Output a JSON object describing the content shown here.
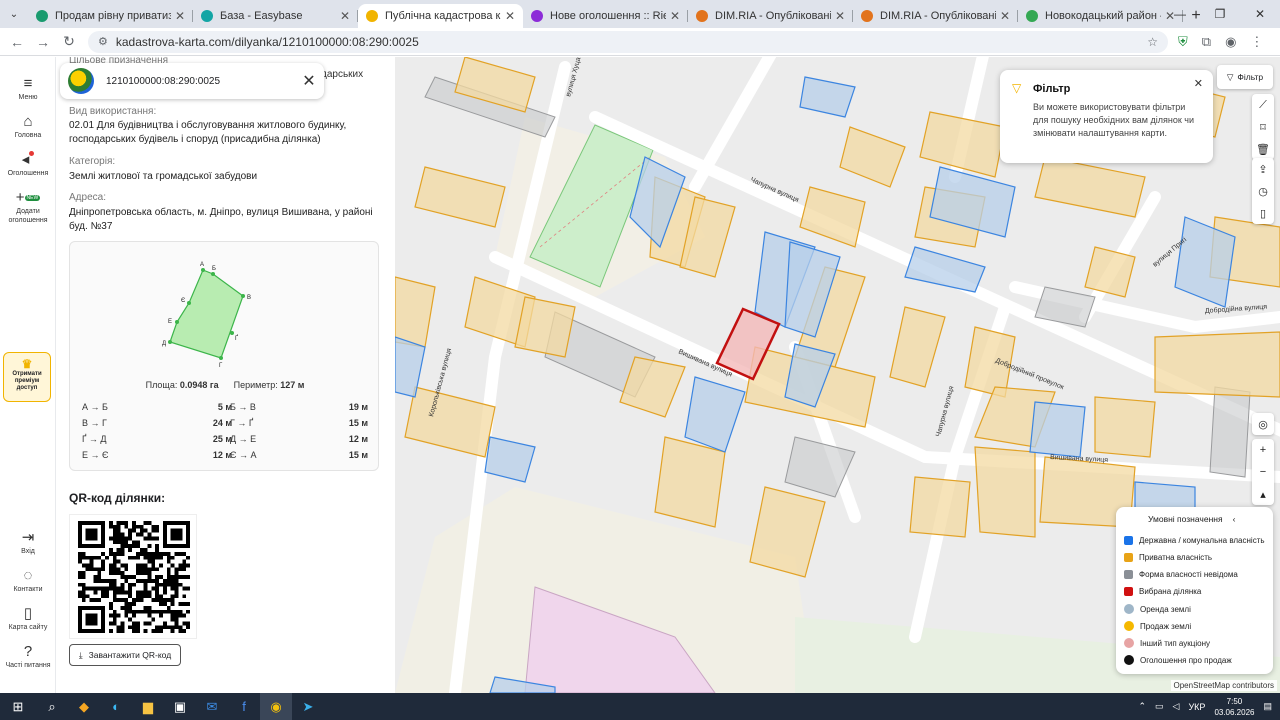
{
  "browser": {
    "tabs": [
      {
        "title": "Продам рівну приватизовану",
        "fav": "#1a9b6f"
      },
      {
        "title": "База - Easybase",
        "fav": "#13a5a5"
      },
      {
        "title": "Публічна кадастрова карта Ук",
        "fav": "#f1b400",
        "active": true
      },
      {
        "title": "Нове оголошення :: Rieltor від",
        "fav": "#8c2bd8"
      },
      {
        "title": "DIM.RIA - Опубліковані оголоше",
        "fav": "#e2731c"
      },
      {
        "title": "DIM.RIA - Опубліковані оголоше",
        "fav": "#e2731c"
      },
      {
        "title": "Новокодацький район – Карт",
        "fav": "#34a853"
      }
    ],
    "url": "kadastrova-karta.com/dilyanka/1210100000:08:290:0025"
  },
  "rail": {
    "items": [
      {
        "label": "Меню",
        "icon": "≡"
      },
      {
        "label": "Головна",
        "icon": "⌂"
      },
      {
        "label": "Оголошення",
        "icon": "◂"
      },
      {
        "label": "Додати оголошення",
        "icon": "+"
      }
    ],
    "premium": "Отримати преміум доступ",
    "bottom": [
      {
        "label": "Вхід",
        "icon": "⇥"
      },
      {
        "label": "Контакти",
        "icon": "◌"
      },
      {
        "label": "Карта сайту",
        "icon": "▯"
      },
      {
        "label": "Часті питання",
        "icon": "?"
      }
    ],
    "new_badge": "NEW"
  },
  "panel": {
    "cadastral_number": "1210100000:08:290:0025",
    "hidden_label": "Цільове призначення",
    "hidden_tail": "дарських",
    "usage_label": "Вид використання:",
    "usage_value": "02.01 Для будівництва і обслуговування житлового будинку, господарських будівель і споруд (присадибна ділянка)",
    "category_label": "Категорія:",
    "category_value": "Землі житлової та громадської забудови",
    "address_label": "Адреса:",
    "address_value": "Дніпропетровська область, м. Дніпро, вулиця Вишивана, у районі буд. №37",
    "area_label": "Площа:",
    "area_value": "0.0948 га",
    "perimeter_label": "Периметр:",
    "perimeter_value": "127 м",
    "vertices": [
      "А",
      "Б",
      "В",
      "Г",
      "Ґ",
      "Д",
      "Е",
      "Є"
    ],
    "segments": [
      {
        "a": "А → Б",
        "av": "5 м",
        "b": "Б → В",
        "bv": "19 м"
      },
      {
        "a": "В → Г",
        "av": "24 м",
        "b": "Г → Ґ",
        "bv": "15 м"
      },
      {
        "a": "Ґ → Д",
        "av": "25 м",
        "b": "Д → Е",
        "bv": "12 м"
      },
      {
        "a": "Е → Є",
        "av": "12 м",
        "b": "Є → А",
        "bv": "15 м"
      }
    ],
    "qr_title": "QR-код ділянки:",
    "qr_button": "Завантажити QR-код"
  },
  "map": {
    "filter_button": "Фільтр",
    "tooltip_title": "Фільтр",
    "tooltip_text": "Ви можете використовувати фільтри для пошуку необхідних вам ділянок чи змінювати налаштування карти.",
    "streets": {
      "chapurna": "Чапурна вулиця",
      "vyshyvana": "Вишивана вулиця",
      "vyshyvana2": "Вишивана вулиця",
      "korolivska": "Корольківська вулиця",
      "dobrodiynyi": "Добродійний провулок",
      "chapurna2": "Чапурна вулиця",
      "prygi": "вулиця Пригі",
      "dobrodiyna": "Добродійна вулиця",
      "khutsa": "вулиця Хуца"
    },
    "legend": {
      "title": "Умовні позначення",
      "items": [
        {
          "label": "Державна / комунальна власність",
          "color": "#1a73e8"
        },
        {
          "label": "Приватна власність",
          "color": "#e8a317"
        },
        {
          "label": "Форма власності невідома",
          "color": "#8a8f96"
        },
        {
          "label": "Вибрана ділянка",
          "color": "#d01010"
        },
        {
          "label": "Оренда землі",
          "color": "#9fb6c8"
        },
        {
          "label": "Продаж землі",
          "color": "#f5b800"
        },
        {
          "label": "Інший тип аукціону",
          "color": "#e7a4a4"
        },
        {
          "label": "Оголошення про продаж",
          "color": "#111111"
        }
      ]
    },
    "attribution": "OpenStreetMap contributors"
  },
  "taskbar": {
    "lang": "УКР",
    "time": "7:50",
    "date": "03.06.2026"
  }
}
